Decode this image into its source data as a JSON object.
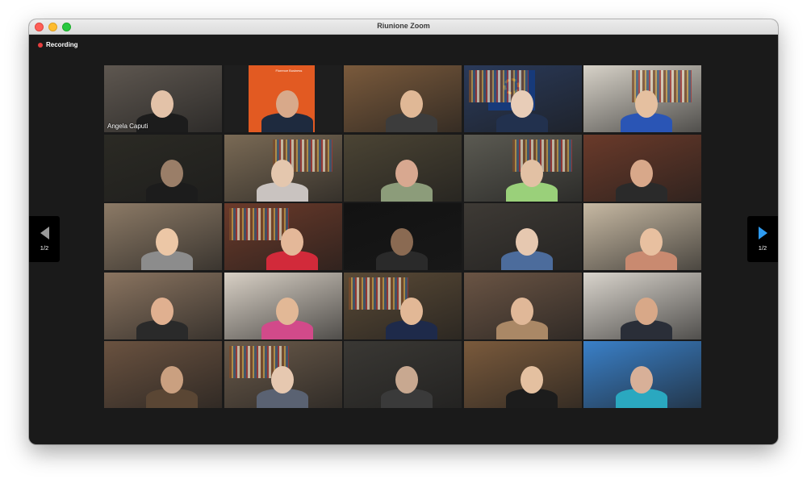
{
  "window": {
    "title": "Riunione Zoom"
  },
  "recording": {
    "label": "Recording",
    "color": "#e63e3e"
  },
  "pagination": {
    "left": "1/2",
    "right": "1/2"
  },
  "participants": [
    {
      "name": "Angela Caputi",
      "active": true,
      "bg": "#5e5750",
      "skin": "#e3c2a8",
      "torso": "#1c1c1c"
    },
    {
      "name": "",
      "bg": "#e25a22",
      "skin": "#d8a98a",
      "torso": "#1e2a3e",
      "label": "Florence Business"
    },
    {
      "name": "",
      "bg": "#7a5a3c",
      "skin": "#e0b896",
      "torso": "#3c3c3c"
    },
    {
      "name": "",
      "bg": "#2a3a5a",
      "skin": "#e8cdb8",
      "torso": "#22314e"
    },
    {
      "name": "",
      "bg": "#d7d2c8",
      "skin": "#e5c0a0",
      "torso": "#2a55b5"
    },
    {
      "name": "",
      "bg": "#2b2a24",
      "skin": "#9a7e68",
      "torso": "#1c1c1c"
    },
    {
      "name": "",
      "bg": "#7a6a55",
      "skin": "#e4c7ae",
      "torso": "#c9c3c0"
    },
    {
      "name": "",
      "bg": "#4b4434",
      "skin": "#d8a890",
      "torso": "#8c9c7a"
    },
    {
      "name": "",
      "bg": "#5b5a52",
      "skin": "#e2c1a4",
      "torso": "#9ad07a"
    },
    {
      "name": "",
      "bg": "#6a3a2a",
      "skin": "#d8a88a",
      "torso": "#2a2a2a"
    },
    {
      "name": "",
      "bg": "#8c7a66",
      "skin": "#ecc7a6",
      "torso": "#8c8c8c"
    },
    {
      "name": "",
      "bg": "#6b3a2a",
      "skin": "#e4b899",
      "torso": "#d22a3a"
    },
    {
      "name": "",
      "bg": "#121212",
      "skin": "#8a6a52",
      "torso": "#2a2a2a"
    },
    {
      "name": "",
      "bg": "#3e3a35",
      "skin": "#e6c8b0",
      "torso": "#4c6c9c"
    },
    {
      "name": "",
      "bg": "#c7b9a3",
      "skin": "#e8c0a0",
      "torso": "#c98a70"
    },
    {
      "name": "",
      "bg": "#8a7460",
      "skin": "#e0b090",
      "torso": "#2a2a2a"
    },
    {
      "name": "",
      "bg": "#d8d0c5",
      "skin": "#e2b896",
      "torso": "#d24a8a"
    },
    {
      "name": "",
      "bg": "#5a4a36",
      "skin": "#e2b896",
      "torso": "#1e2a4a"
    },
    {
      "name": "",
      "bg": "#6a5444",
      "skin": "#e0b898",
      "torso": "#aa8866"
    },
    {
      "name": "",
      "bg": "#d9d4cc",
      "skin": "#d8a888",
      "torso": "#2a2e38"
    },
    {
      "name": "",
      "bg": "#6a5240",
      "skin": "#caa080",
      "torso": "#5a4634"
    },
    {
      "name": "",
      "bg": "#6a5a4a",
      "skin": "#e6c8b0",
      "torso": "#5a6272"
    },
    {
      "name": "",
      "bg": "#3a3834",
      "skin": "#c8a890",
      "torso": "#3a3a3a"
    },
    {
      "name": "",
      "bg": "#7a5a3c",
      "skin": "#e4c0a0",
      "torso": "#1c1c1c"
    },
    {
      "name": "",
      "bg": "#3a80c8",
      "skin": "#d8b098",
      "torso": "#2aa8c0"
    }
  ]
}
